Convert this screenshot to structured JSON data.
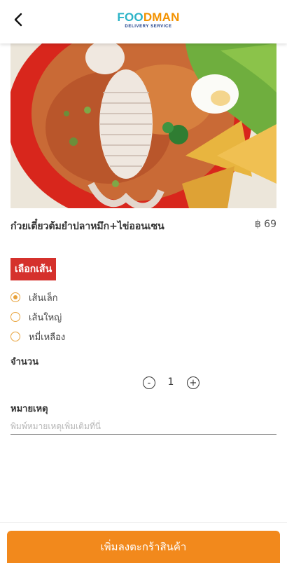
{
  "header": {
    "back_icon": "chevron-left-icon",
    "logo_part1": "FOO",
    "logo_part2": "DMAN",
    "logo_sub": "DELIVERY SERVICE"
  },
  "item": {
    "name": "ก๋วยเตี๋ยวต้มยำปลาหมึก+ไข่ออนเซน",
    "price": "฿ 69"
  },
  "noodle_section": {
    "title": "เลือกเส้น",
    "options": [
      {
        "label": "เส้นเล็ก",
        "checked": true
      },
      {
        "label": "เส้นใหญ่",
        "checked": false
      },
      {
        "label": "หมี่เหลือง",
        "checked": false
      }
    ]
  },
  "quantity": {
    "label": "จำนวน",
    "minus": "-",
    "value": "1",
    "plus": "+"
  },
  "note": {
    "label": "หมายเหตุ",
    "placeholder": "พิมพ์หมายเหตุเพิ่มเติมที่นี่"
  },
  "footer": {
    "add_to_cart": "เพิ่มลงตะกร้าสินค้า"
  },
  "colors": {
    "accent_orange": "#f2891c",
    "badge_red": "#d5312c",
    "radio_orange": "#e8a23b",
    "logo_teal": "#2bb3c7",
    "logo_orange": "#f39200"
  }
}
